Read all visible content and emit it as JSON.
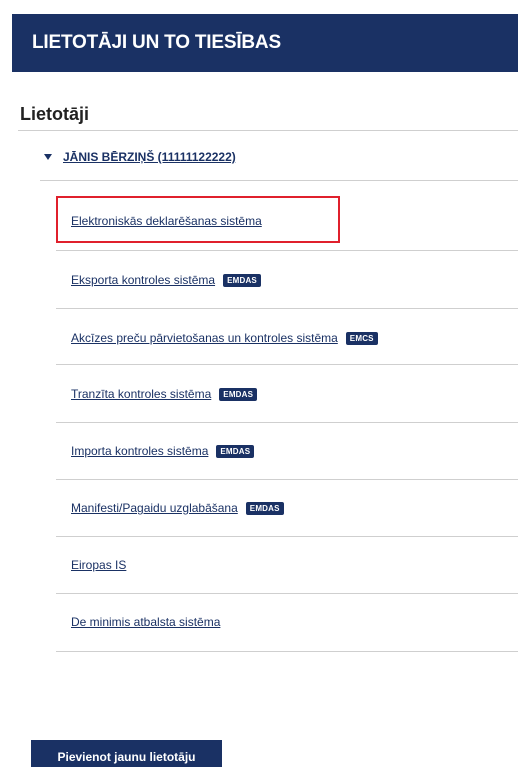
{
  "header": {
    "title": "LIETOTĀJI UN TO TIESĪBAS"
  },
  "users_section": {
    "title": "Lietotāji",
    "user": {
      "label": "JĀNIS BĒRZIŅŠ (11111122222)",
      "expanded": true
    },
    "systems": [
      {
        "label": "Elektroniskās deklarēšanas sistēma",
        "badge": "",
        "highlighted": true
      },
      {
        "label": "Eksporta kontroles sistēma",
        "badge": "EMDAS"
      },
      {
        "label": "Akcīzes preču pārvietošanas un kontroles sistēma",
        "badge": "EMCS"
      },
      {
        "label": "Tranzīta kontroles sistēma",
        "badge": "EMDAS"
      },
      {
        "label": "Importa kontroles sistēma",
        "badge": "EMDAS"
      },
      {
        "label": "Manifesti/Pagaidu uzglabāšana",
        "badge": "EMDAS"
      },
      {
        "label": "Eiropas IS",
        "badge": ""
      },
      {
        "label": "De minimis atbalsta sistēma",
        "badge": ""
      }
    ]
  },
  "actions": {
    "add_user_label": "Pievienot jaunu lietotāju"
  },
  "colors": {
    "brand": "#1a3164",
    "highlight": "#e0202c"
  }
}
